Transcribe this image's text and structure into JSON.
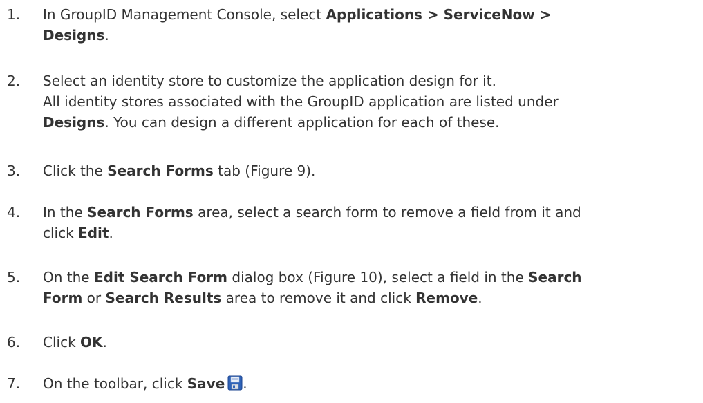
{
  "steps": [
    {
      "number": "1.",
      "line1_text": "In GroupID Management Console, select ",
      "line1_bold": "Applications > ServiceNow >",
      "line2_bold": "Designs",
      "line2_tail": "."
    },
    {
      "number": "2.",
      "line1": "Select an identity store to customize the application design for it.",
      "line2": "All identity stores associated with the GroupID application are listed under",
      "line3_bold": "Designs",
      "line3_tail": ". You can design a different application for each of these."
    },
    {
      "number": "3.",
      "text_before": "Click the ",
      "bold": "Search Forms",
      "text_after": " tab (Figure 9)."
    },
    {
      "number": "4.",
      "line1_before": "In the ",
      "line1_bold": "Search Forms",
      "line1_after": " area, select a search form to remove a field from it and",
      "line2_before": "click ",
      "line2_bold": "Edit",
      "line2_after": "."
    },
    {
      "number": "5.",
      "line1_before": "On the ",
      "line1_bold1": "Edit Search Form",
      "line1_mid": " dialog box (Figure 10), select a field in the ",
      "line1_bold2": "Search",
      "line2_bold1": "Form",
      "line2_mid1": " or ",
      "line2_bold2": "Search Results",
      "line2_mid2": " area to remove it and click ",
      "line2_bold3": "Remove",
      "line2_after": "."
    },
    {
      "number": "6.",
      "text_before": "Click ",
      "bold": "OK",
      "text_after": "."
    },
    {
      "number": "7.",
      "text_before": "On the toolbar, click ",
      "bold": "Save",
      "text_after": ".",
      "icon": "save-floppy-icon"
    }
  ],
  "colors": {
    "text": "#333333",
    "icon_blue": "#2f63b8"
  }
}
